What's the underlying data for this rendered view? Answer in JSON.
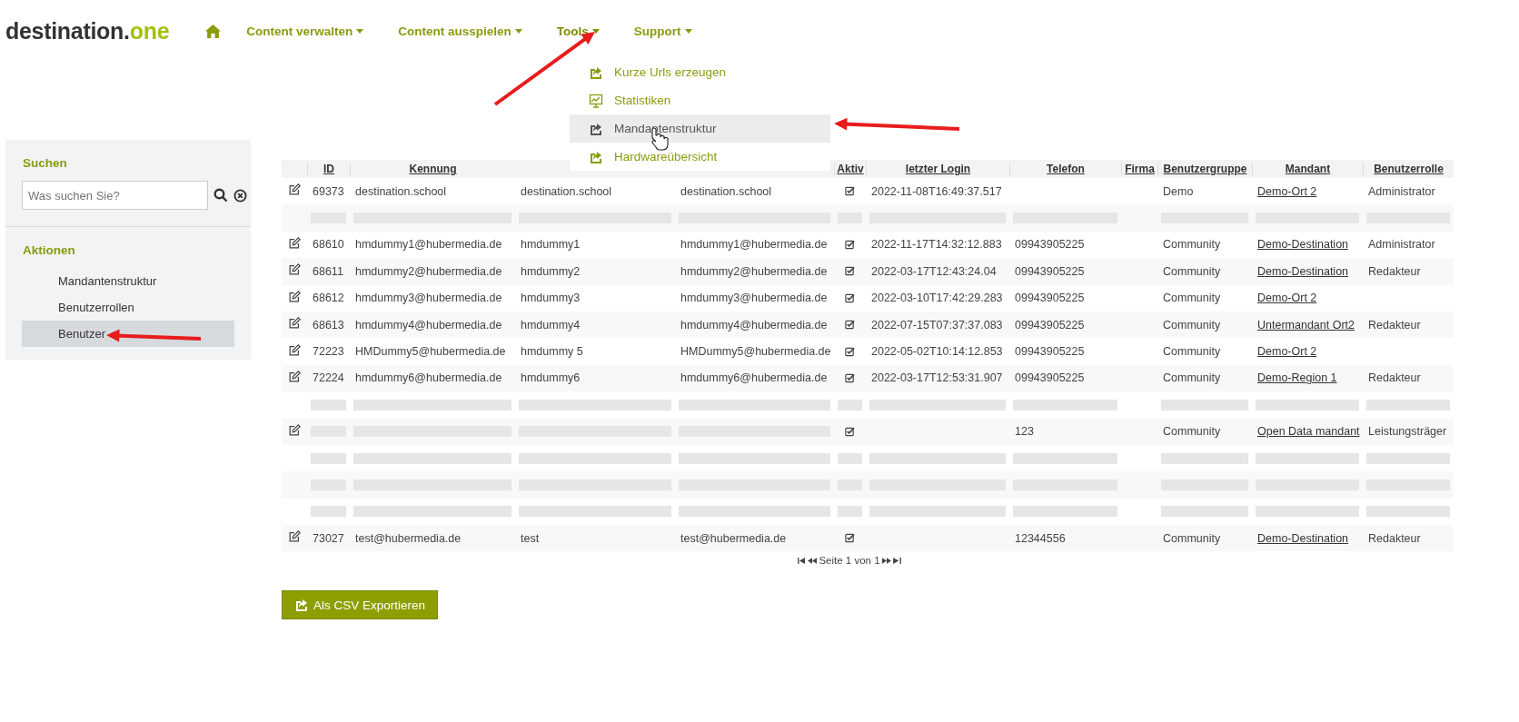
{
  "logo": {
    "text": "destination.",
    "accent": "one"
  },
  "nav": [
    {
      "label": "Content verwalten",
      "selected": false
    },
    {
      "label": "Content ausspielen",
      "selected": false
    },
    {
      "label": "Tools",
      "selected": true
    },
    {
      "label": "Support",
      "selected": false
    }
  ],
  "tools_menu": [
    {
      "label": "Kurze Urls erzeugen",
      "kind": "share",
      "selected": false
    },
    {
      "label": "Statistiken",
      "kind": "chart",
      "selected": false
    },
    {
      "label": "Mandantenstruktur",
      "kind": "share",
      "selected": true
    },
    {
      "label": "Hardwareübersicht",
      "kind": "share",
      "selected": false
    }
  ],
  "sidebar": {
    "search_title": "Suchen",
    "search": {
      "placeholder": "Was suchen Sie?"
    },
    "actions_title": "Aktionen",
    "items": [
      {
        "label": "Mandantenstruktur",
        "selected": false
      },
      {
        "label": "Benutzerrollen",
        "selected": false
      },
      {
        "label": "Benutzer",
        "selected": true
      }
    ]
  },
  "table": {
    "columns": [
      "",
      "ID",
      "Kennung",
      "",
      "",
      "Aktiv",
      "letzter Login",
      "Telefon",
      "Firma",
      "Benutzergruppe",
      "Mandant",
      "Benutzerrolle"
    ],
    "rows": [
      {
        "kind": "user",
        "id": "69373",
        "kennung": "destination.school",
        "column_3": "destination.school",
        "column_4": "destination.school",
        "active": true,
        "login": "2022-11-08T16:49:37.517",
        "telefon": "",
        "gruppe": "Demo",
        "mandant": "Demo-Ort 2",
        "rolle": "Administrator"
      },
      {
        "kind": "blurred"
      },
      {
        "kind": "user",
        "id": "68610",
        "kennung": "hmdummy1@hubermedia.de",
        "column_3": "hmdummy1",
        "column_4": "hmdummy1@hubermedia.de",
        "active": true,
        "login": "2022-11-17T14:32:12.883",
        "telefon": "09943905225",
        "gruppe": "Community",
        "mandant": "Demo-Destination",
        "rolle": "Administrator"
      },
      {
        "kind": "user",
        "id": "68611",
        "kennung": "hmdummy2@hubermedia.de",
        "column_3": "hmdummy2",
        "column_4": "hmdummy2@hubermedia.de",
        "active": true,
        "login": "2022-03-17T12:43:24.04",
        "telefon": "09943905225",
        "gruppe": "Community",
        "mandant": "Demo-Destination",
        "rolle": "Redakteur"
      },
      {
        "kind": "user",
        "id": "68612",
        "kennung": "hmdummy3@hubermedia.de",
        "column_3": "hmdummy3",
        "column_4": "hmdummy3@hubermedia.de",
        "active": true,
        "login": "2022-03-10T17:42:29.283",
        "telefon": "09943905225",
        "gruppe": "Community",
        "mandant": "Demo-Ort 2",
        "rolle": ""
      },
      {
        "kind": "user",
        "id": "68613",
        "kennung": "hmdummy4@hubermedia.de",
        "column_3": "hmdummy4",
        "column_4": "hmdummy4@hubermedia.de",
        "active": true,
        "login": "2022-07-15T07:37:37.083",
        "telefon": "09943905225",
        "gruppe": "Community",
        "mandant": "Untermandant Ort2",
        "rolle": "Redakteur"
      },
      {
        "kind": "user",
        "id": "72223",
        "kennung": "HMDummy5@hubermedia.de",
        "column_3": "hmdummy 5",
        "column_4": "HMDummy5@hubermedia.de",
        "active": true,
        "login": "2022-05-02T10:14:12.853",
        "telefon": "09943905225",
        "gruppe": "Community",
        "mandant": "Demo-Ort 2",
        "rolle": ""
      },
      {
        "kind": "user",
        "id": "72224",
        "kennung": "hmdummy6@hubermedia.de",
        "column_3": "hmdummy6",
        "column_4": "hmdummy6@hubermedia.de",
        "active": true,
        "login": "2022-03-17T12:53:31.907",
        "telefon": "09943905225",
        "gruppe": "Community",
        "mandant": "Demo-Region 1",
        "rolle": "Redakteur"
      },
      {
        "kind": "blurred"
      },
      {
        "kind": "user",
        "id": null,
        "kennung": null,
        "column_3": null,
        "column_4": null,
        "active": true,
        "login": "",
        "telefon": "123",
        "gruppe": "Community",
        "mandant": "Open Data mandant",
        "rolle": "Leistungsträger"
      },
      {
        "kind": "blurred"
      },
      {
        "kind": "blurred"
      },
      {
        "kind": "blurred"
      },
      {
        "kind": "user",
        "id": "73027",
        "kennung": "test@hubermedia.de",
        "column_3": "test",
        "column_4": "test@hubermedia.de",
        "active": true,
        "login": "",
        "telefon": "12344556",
        "gruppe": "Community",
        "mandant": "Demo-Destination",
        "rolle": "Redakteur"
      }
    ],
    "pagination": "Seite 1 von 1"
  },
  "export_button": "Als CSV Exportieren"
}
